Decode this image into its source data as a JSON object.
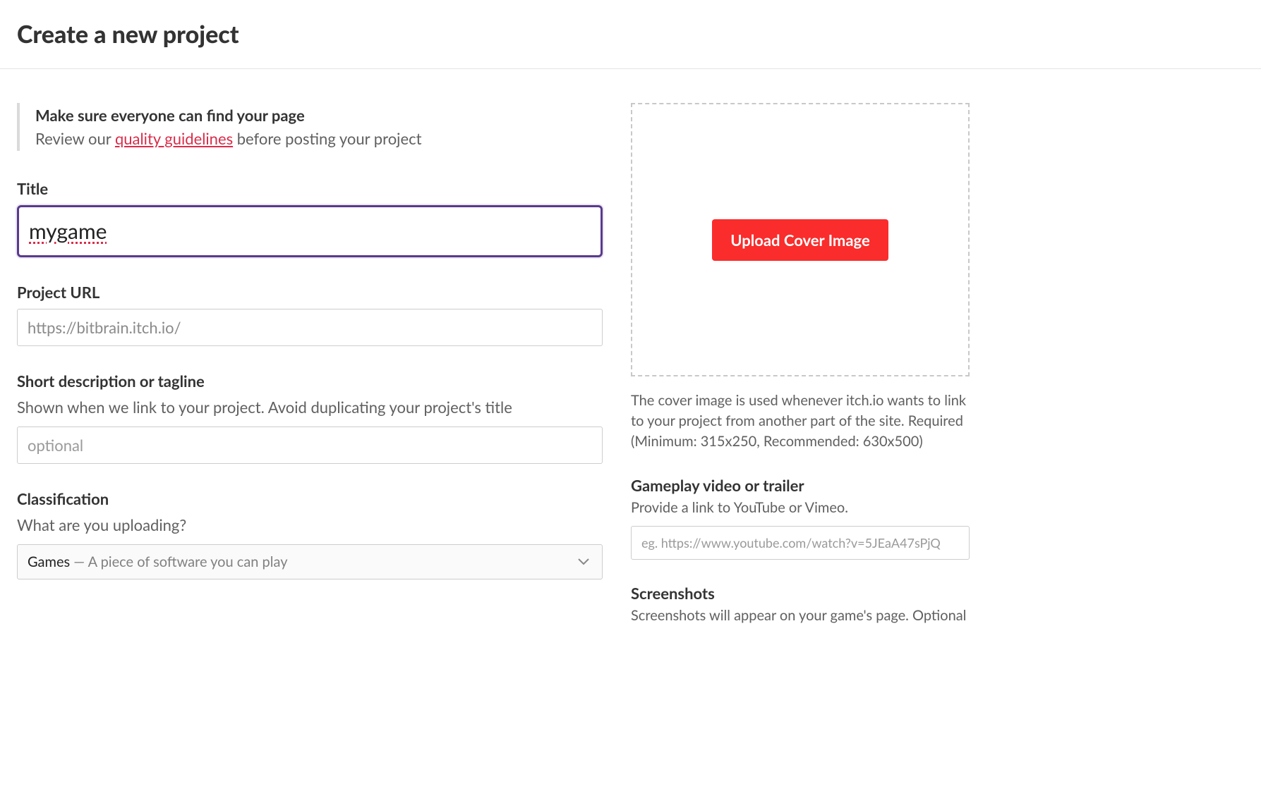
{
  "header": {
    "title": "Create a new project"
  },
  "notice": {
    "title": "Make sure everyone can find your page",
    "prefix": "Review our ",
    "link": "quality guidelines",
    "suffix": " before posting your project"
  },
  "fields": {
    "title": {
      "label": "Title",
      "value": "mygame"
    },
    "project_url": {
      "label": "Project URL",
      "value": "https://bitbrain.itch.io/"
    },
    "short_desc": {
      "label": "Short description or tagline",
      "sub": "Shown when we link to your project. Avoid duplicating your project's title",
      "placeholder": "optional"
    },
    "classification": {
      "label": "Classification",
      "sub": "What are you uploading?",
      "selected_strong": "Games",
      "selected_rest": " — A piece of software you can play"
    }
  },
  "side": {
    "upload_button": "Upload Cover Image",
    "cover_hint": "The cover image is used whenever itch.io wants to link to your project from another part of the site. Required (Minimum: 315x250, Recommended: 630x500)",
    "video": {
      "label": "Gameplay video or trailer",
      "sub": "Provide a link to YouTube or Vimeo.",
      "placeholder": "eg. https://www.youtube.com/watch?v=5JEaA47sPjQ"
    },
    "screenshots": {
      "label": "Screenshots",
      "sub": "Screenshots will appear on your game's page. Optional"
    }
  }
}
